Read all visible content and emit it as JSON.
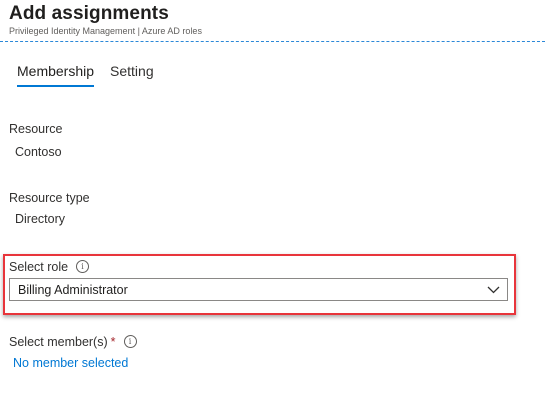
{
  "header": {
    "title": "Add assignments",
    "subtitle": "Privileged Identity Management | Azure AD roles"
  },
  "tabs": [
    {
      "label": "Membership",
      "active": true
    },
    {
      "label": "Setting",
      "active": false
    }
  ],
  "resource": {
    "label": "Resource",
    "value": "Contoso"
  },
  "resource_type": {
    "label": "Resource type",
    "value": "Directory"
  },
  "select_role": {
    "label": "Select role",
    "info_icon": "i",
    "value": "Billing Administrator"
  },
  "select_members": {
    "label": "Select member(s)",
    "required_mark": "*",
    "info_icon": "i",
    "link_text": "No member selected"
  },
  "colors": {
    "accent": "#0078d4",
    "highlight": "#e8353b",
    "required": "#a4262c"
  }
}
